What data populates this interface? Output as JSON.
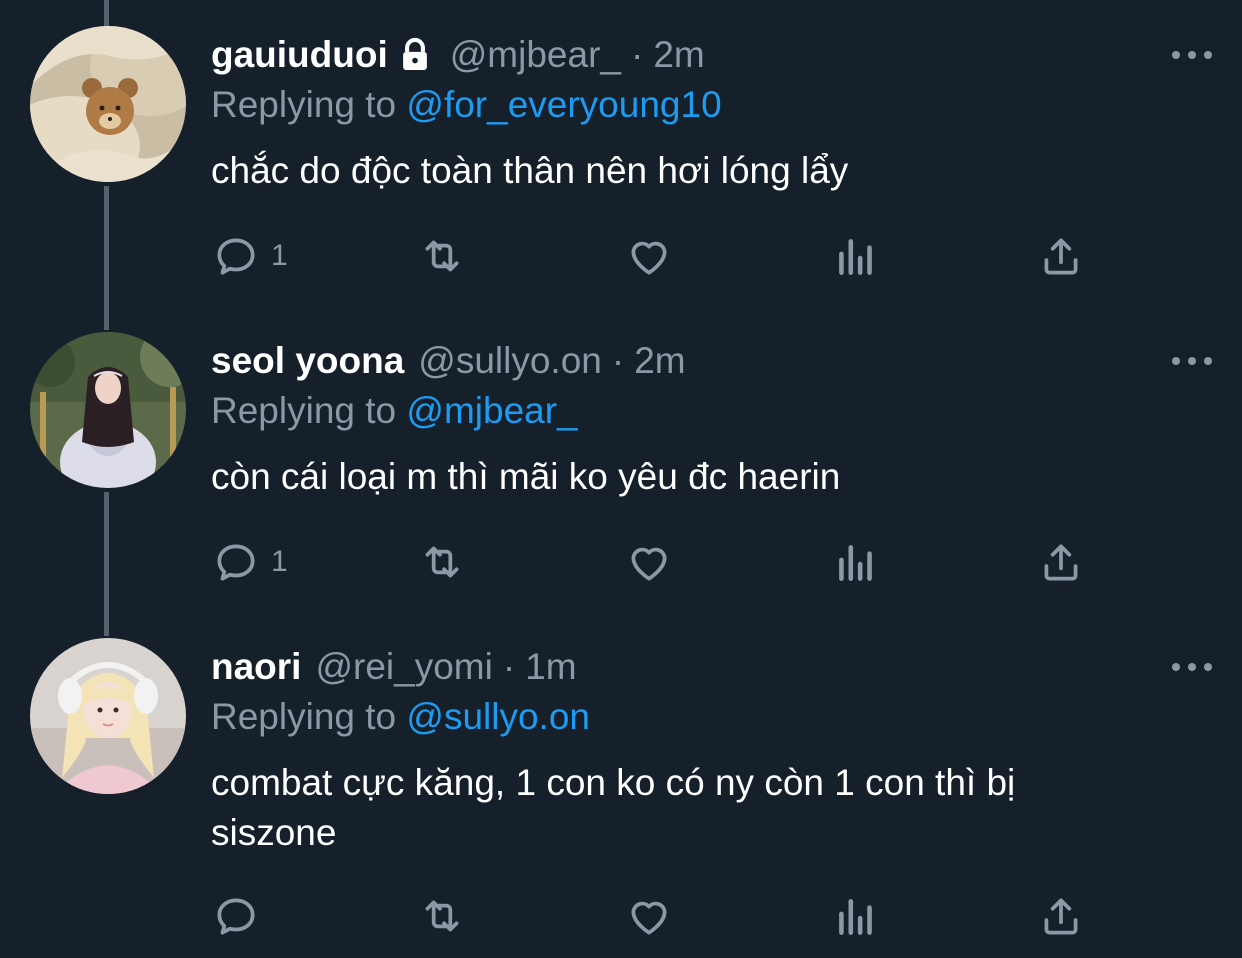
{
  "colors": {
    "background": "#15202b",
    "secondary_text": "#8b98a5",
    "mention": "#1d9bf0",
    "primary_text": "#ffffff"
  },
  "tweets": [
    {
      "name": "gauiuduoi",
      "protected": true,
      "handle": "@mjbear_",
      "dot": "·",
      "time": "2m",
      "replying_prefix": "Replying to",
      "replying_to": "@for_everyoung10",
      "text": "chắc do độc toàn thân nên hơi lóng lẩy",
      "reply_count": "1",
      "avatar_icon": "teddy-bear-avatar"
    },
    {
      "name": "seol yoona",
      "protected": false,
      "handle": "@sullyo.on",
      "dot": "·",
      "time": "2m",
      "replying_prefix": "Replying to",
      "replying_to": "@mjbear_",
      "text": "còn cái loại m thì mãi ko yêu đc haerin",
      "reply_count": "1",
      "avatar_icon": "girl-in-garden-avatar"
    },
    {
      "name": "naori",
      "protected": false,
      "handle": "@rei_yomi",
      "dot": "·",
      "time": "1m",
      "replying_prefix": "Replying to",
      "replying_to": "@sullyo.on",
      "text": "combat cực kăng, 1 con ko có ny còn 1 con thì bị siszone",
      "reply_count": "",
      "avatar_icon": "blonde-girl-headphones-avatar"
    }
  ]
}
